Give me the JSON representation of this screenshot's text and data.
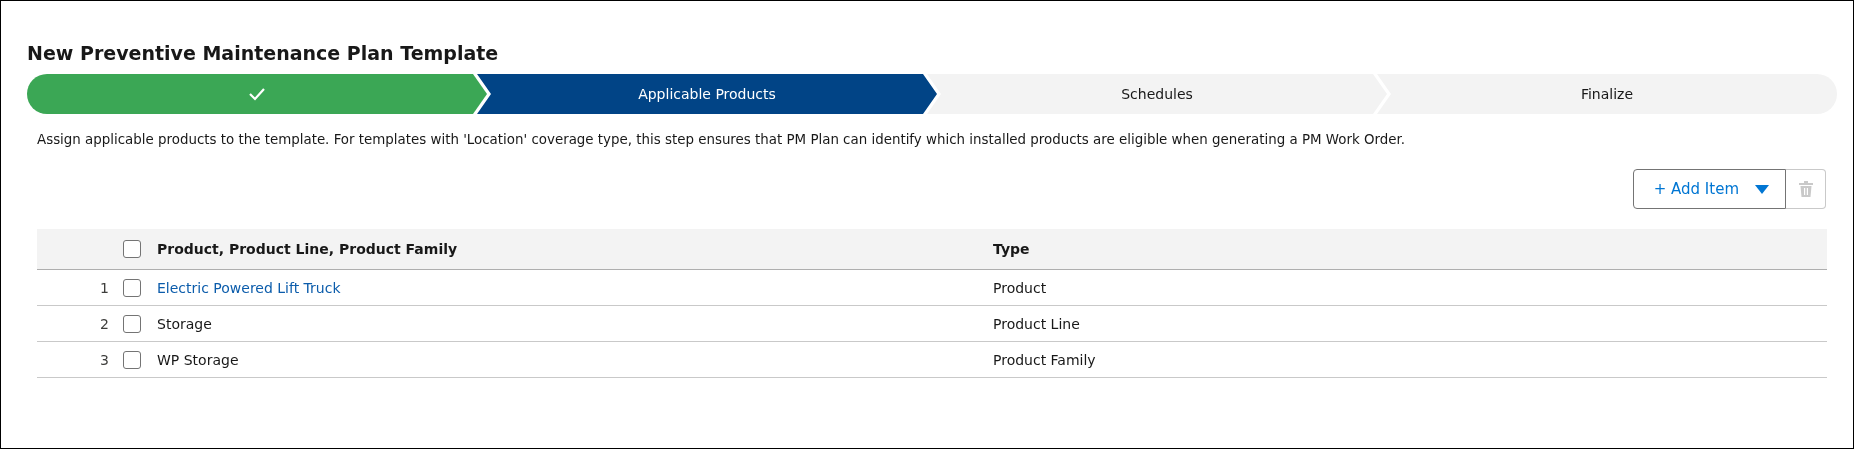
{
  "title": "New Preventive Maintenance Plan Template",
  "path": [
    {
      "complete": true,
      "selected": false
    },
    {
      "label": "Applicable Products",
      "complete": false,
      "selected": true
    },
    {
      "label": "Schedules",
      "complete": false,
      "selected": false
    },
    {
      "label": "Finalize",
      "complete": false,
      "selected": false
    }
  ],
  "description": "Assign applicable products to the template. For templates with 'Location' coverage type, this step ensures that PM Plan can identify which installed products are eligible when generating a PM Work Order.",
  "actions": {
    "add_item": "+ Add Item",
    "delete_disabled": true
  },
  "table": {
    "select_all_checked": false,
    "columns": [
      "Product, Product Line, Product Family",
      "Type"
    ],
    "rows": [
      {
        "number": "1",
        "checked": false,
        "kind": "link",
        "name": "Electric Powered Lift Truck",
        "type": "Product"
      },
      {
        "number": "2",
        "checked": false,
        "kind": "text",
        "name": "Storage",
        "type": "Product Line"
      },
      {
        "number": "3",
        "checked": false,
        "kind": "text",
        "name": "WP Storage",
        "type": "Product Family"
      }
    ]
  }
}
